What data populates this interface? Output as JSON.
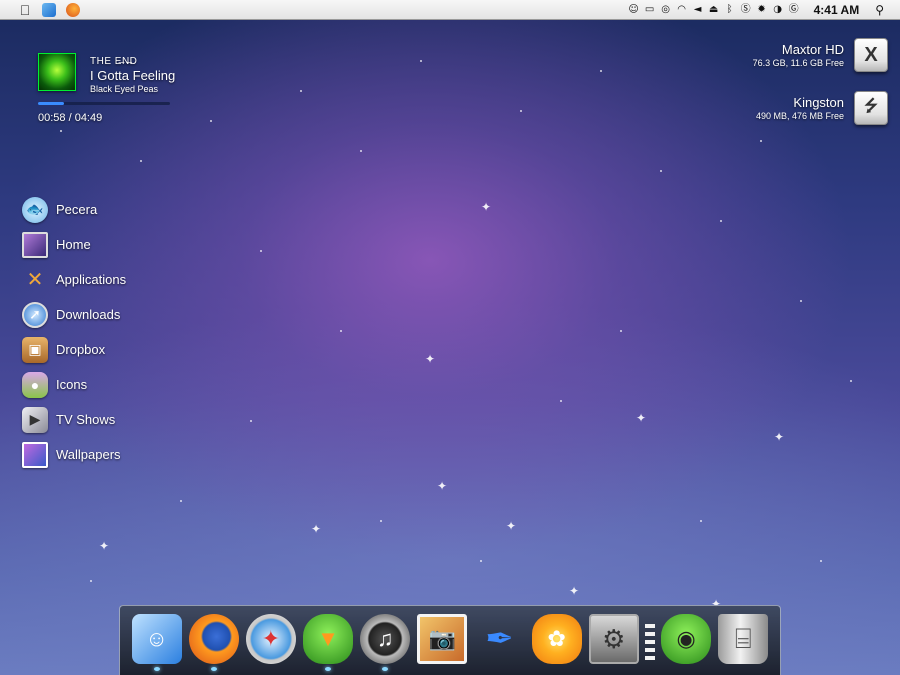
{
  "menubar": {
    "left_icons": [
      "apple-icon",
      "finder-icon",
      "firefox-icon"
    ],
    "tray_icons": [
      "alien-icon",
      "drive-icon",
      "sync-icon",
      "wifi-icon",
      "volume-icon",
      "eject-icon",
      "bluetooth-icon",
      "skype-icon",
      "gear-icon",
      "contrast-icon",
      "growl-icon"
    ],
    "clock": "4:41 AM",
    "search_icon": "magnifier-icon"
  },
  "now_playing": {
    "album": "THE E̶N̶D",
    "title": "I Gotta Feeling",
    "artist": "Black Eyed Peas",
    "time": "00:58 / 04:49",
    "progress_fraction": 0.2
  },
  "drives": [
    {
      "name": "Maxtor HD",
      "info": "76.3 GB, 11.6 GB Free",
      "icon": "x-drive-icon"
    },
    {
      "name": "Kingston",
      "info": "490 MB, 476 MB Free",
      "icon": "usb-drive-icon"
    }
  ],
  "places": [
    {
      "label": "Pecera",
      "icon": "fishbowl-icon",
      "color": "#6fb6e8"
    },
    {
      "label": "Home",
      "icon": "imac-icon",
      "color": "#7a4aa8"
    },
    {
      "label": "Applications",
      "icon": "applications-icon",
      "color": "#e29b2a"
    },
    {
      "label": "Downloads",
      "icon": "safari-download-icon",
      "color": "#4a90d8"
    },
    {
      "label": "Dropbox",
      "icon": "dropbox-icon",
      "color": "#c8853a"
    },
    {
      "label": "Icons",
      "icon": "jar-icon",
      "color": "#8ac44a"
    },
    {
      "label": "TV Shows",
      "icon": "tv-icon",
      "color": "#b0b0b8"
    },
    {
      "label": "Wallpapers",
      "icon": "wallpapers-icon",
      "color": "#4a6ac8"
    }
  ],
  "dock": {
    "items": [
      {
        "app": "finder-icon",
        "running": true
      },
      {
        "app": "firefox-icon",
        "running": true
      },
      {
        "app": "safari-icon",
        "running": false
      },
      {
        "app": "adium-icon",
        "running": true
      },
      {
        "app": "itunes-headphones-icon",
        "running": true
      },
      {
        "app": "iphoto-icon",
        "running": false
      },
      {
        "app": "quill-icon",
        "running": false
      },
      {
        "app": "flower-icon",
        "running": false
      },
      {
        "app": "system-preferences-icon",
        "running": false
      },
      {
        "app": "adium-bot-icon",
        "running": false
      },
      {
        "app": "trash-icon",
        "running": false
      }
    ]
  }
}
